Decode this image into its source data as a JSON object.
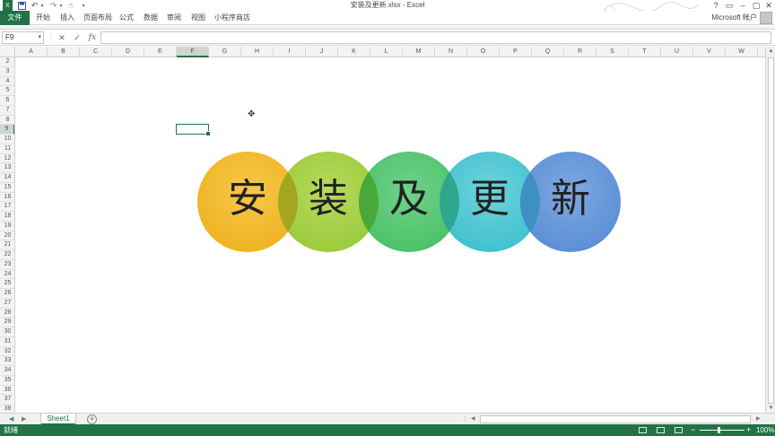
{
  "window": {
    "title": "安装及更新.xlsx - Excel",
    "controls": [
      "?",
      "▭",
      "–",
      "▢",
      "✕"
    ]
  },
  "quick_access": {
    "icons": [
      "excel-logo-icon",
      "save-icon",
      "undo-icon",
      "redo-icon",
      "touch-mode-icon",
      "customize-icon"
    ]
  },
  "ribbon": {
    "file_tab": "文件",
    "tabs": [
      "开始",
      "插入",
      "页面布局",
      "公式",
      "数据",
      "审阅",
      "视图",
      "小程序商店"
    ],
    "account": "Microsoft 帐户"
  },
  "formula_bar": {
    "name_box": "F9",
    "cancel": "✕",
    "enter": "✓",
    "fx": "fx",
    "value": ""
  },
  "columns": [
    "A",
    "B",
    "C",
    "D",
    "E",
    "F",
    "G",
    "H",
    "I",
    "J",
    "K",
    "L",
    "M",
    "N",
    "O",
    "P",
    "Q",
    "R",
    "S",
    "T",
    "U",
    "V",
    "W"
  ],
  "selected_column": "F",
  "rows": [
    "2",
    "3",
    "4",
    "5",
    "6",
    "7",
    "8",
    "9",
    "10",
    "11",
    "12",
    "13",
    "14",
    "15",
    "16",
    "17",
    "18",
    "19",
    "20",
    "21",
    "22",
    "23",
    "24",
    "25",
    "26",
    "27",
    "28",
    "29",
    "30",
    "31",
    "32",
    "33",
    "34",
    "35",
    "36",
    "37",
    "38"
  ],
  "selected_row": "9",
  "graphic": {
    "circles": [
      {
        "label": "安",
        "color": "#f0b323"
      },
      {
        "label": "装",
        "color": "#9fcc3b"
      },
      {
        "label": "及",
        "color": "#4cc26a"
      },
      {
        "label": "更",
        "color": "#41c1cf"
      },
      {
        "label": "新",
        "color": "#5b8fd6"
      }
    ],
    "overlap_colors": [
      "#a4a620",
      "#4aa83a",
      "#2fa78e",
      "#3e8fc4"
    ]
  },
  "sheets": {
    "tabs": [
      "Sheet1"
    ],
    "active": "Sheet1",
    "add_label": "+"
  },
  "status": {
    "text": "就绪",
    "zoom_minus": "−",
    "zoom_plus": "+",
    "zoom_level": "100%",
    "zoom_value": 100
  },
  "colors": {
    "accent": "#217346"
  }
}
